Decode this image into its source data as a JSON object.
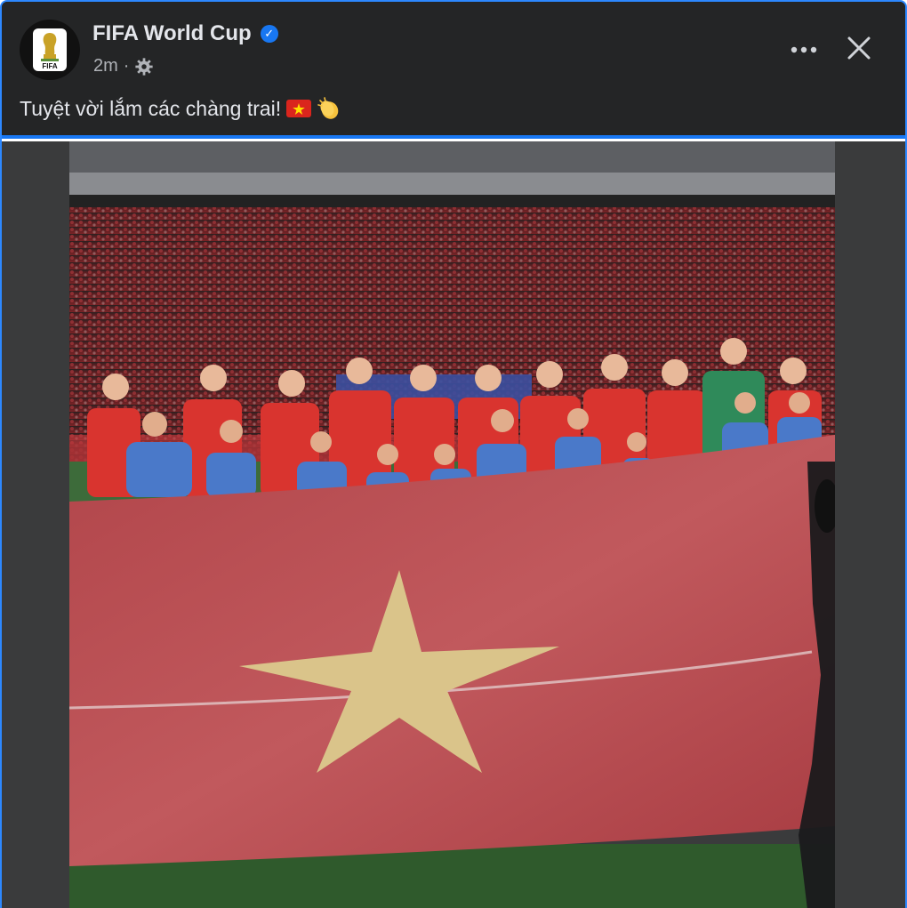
{
  "post": {
    "page_name": "FIFA World Cup",
    "timestamp": "2m",
    "separator": "·",
    "privacy_icon": "gear-icon",
    "caption_text": "Tuyệt vời lắm các chàng trai!",
    "caption_emojis": [
      "vietnam-flag-emoji",
      "clapping-hands-emoji"
    ],
    "avatar_text": "FIFA"
  },
  "colors": {
    "background": "#242526",
    "accent": "#1877f2",
    "text_primary": "#e4e6eb",
    "text_secondary": "#b0b3b8"
  }
}
